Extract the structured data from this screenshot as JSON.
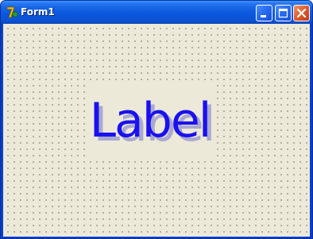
{
  "window": {
    "title": "Form1",
    "app_icon": "delphi-7-icon",
    "buttons": {
      "minimize": "minimize-icon",
      "maximize": "maximize-icon",
      "close": "close-icon"
    }
  },
  "form": {
    "grid": "dotted-design-grid",
    "label": {
      "text": "Label",
      "color": "#1a10f0",
      "shadow_color": "#a9a9d0"
    }
  },
  "colors": {
    "titlebar": "#0a56dc",
    "client_background": "#ece9d8",
    "close_button": "#e2602f"
  }
}
